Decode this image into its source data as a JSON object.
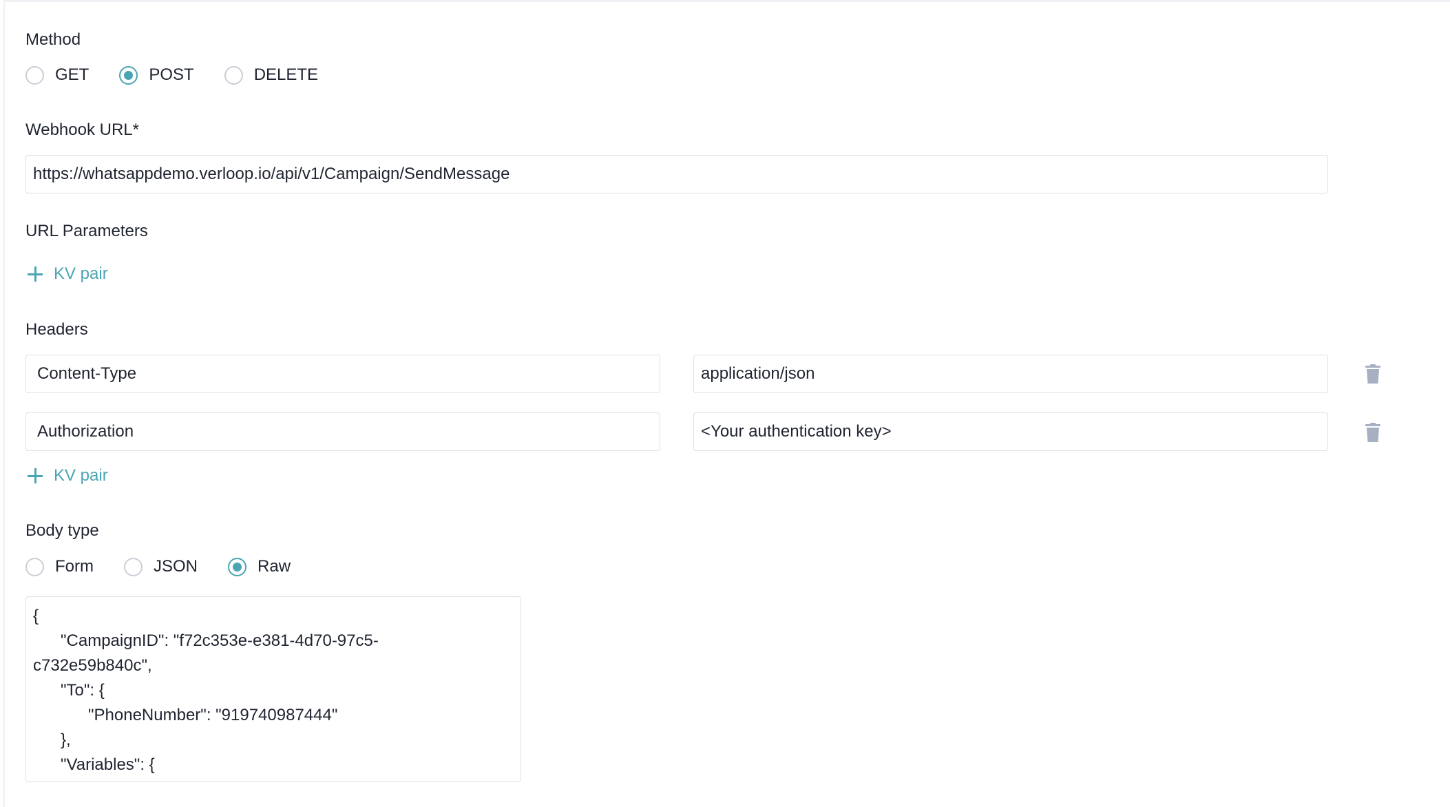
{
  "method": {
    "label": "Method",
    "options": [
      {
        "label": "GET",
        "checked": false
      },
      {
        "label": "POST",
        "checked": true
      },
      {
        "label": "DELETE",
        "checked": false
      }
    ]
  },
  "webhook": {
    "label": "Webhook URL*",
    "value": "https://whatsappdemo.verloop.io/api/v1/Campaign/SendMessage"
  },
  "url_params": {
    "label": "URL Parameters",
    "add_label": "KV pair"
  },
  "headers": {
    "label": "Headers",
    "rows": [
      {
        "key": "Content-Type",
        "value": "application/json"
      },
      {
        "key": "Authorization",
        "value": "<Your authentication key>"
      }
    ],
    "add_label": "KV pair"
  },
  "body_type": {
    "label": "Body type",
    "options": [
      {
        "label": "Form",
        "checked": false
      },
      {
        "label": "JSON",
        "checked": false
      },
      {
        "label": "Raw",
        "checked": true
      }
    ]
  },
  "body_raw": {
    "lines": [
      "{",
      "      \"CampaignID\": \"f72c353e-e381-4d70-97c5-",
      "c732e59b840c\",",
      "      \"To\": {",
      "            \"PhoneNumber\": \"919740987444\"",
      "      },",
      "      \"Variables\": {"
    ]
  },
  "colors": {
    "accent": "#4aa4b3",
    "trash": "#a7afc2",
    "border": "#dde1e7"
  }
}
